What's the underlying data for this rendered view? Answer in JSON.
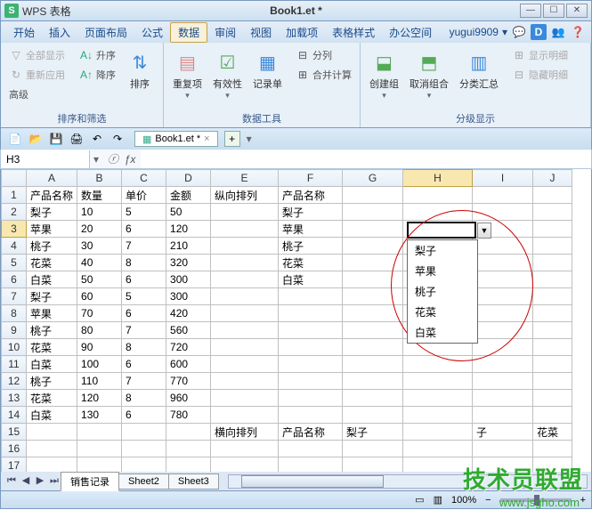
{
  "title_bar": {
    "app_name": "WPS 表格",
    "doc_title": "Book1.et *"
  },
  "menu": {
    "items": [
      "开始",
      "插入",
      "页面布局",
      "公式",
      "数据",
      "审阅",
      "视图",
      "加载项",
      "表格样式",
      "办公空间"
    ],
    "active_index": 4,
    "user": "yugui9909"
  },
  "ribbon": {
    "g1": {
      "show_all": "全部显示",
      "reapply": "重新应用",
      "advanced": "高级",
      "asc": "升序",
      "desc": "降序",
      "sort": "排序",
      "label": "排序和筛选"
    },
    "g2": {
      "dup": "重复项",
      "validity": "有效性",
      "form": "记录单",
      "split": "分列",
      "consolidate": "合并计算",
      "label": "数据工具"
    },
    "g3": {
      "group": "创建组",
      "ungroup": "取消组合",
      "subtotal": "分类汇总",
      "show_detail": "显示明细",
      "hide_detail": "隐藏明细",
      "label": "分级显示"
    }
  },
  "quick_access": {
    "doc_tab": "Book1.et *"
  },
  "name_box": {
    "value": "H3"
  },
  "columns": [
    "A",
    "B",
    "C",
    "D",
    "E",
    "F",
    "G",
    "H",
    "I",
    "J"
  ],
  "headers": {
    "c0": "产品名称",
    "c1": "数量",
    "c2": "单价",
    "c3": "金额",
    "c4": "纵向排列",
    "c5": "产品名称"
  },
  "rows": [
    {
      "r": "1",
      "a": "产品名称",
      "b": "数量",
      "c": "单价",
      "d": "金额",
      "e": "纵向排列",
      "f": "产品名称"
    },
    {
      "r": "2",
      "a": "梨子",
      "b": "10",
      "c": "5",
      "d": "50",
      "f": "梨子"
    },
    {
      "r": "3",
      "a": "苹果",
      "b": "20",
      "c": "6",
      "d": "120",
      "f": "苹果"
    },
    {
      "r": "4",
      "a": "桃子",
      "b": "30",
      "c": "7",
      "d": "210",
      "f": "桃子"
    },
    {
      "r": "5",
      "a": "花菜",
      "b": "40",
      "c": "8",
      "d": "320",
      "f": "花菜"
    },
    {
      "r": "6",
      "a": "白菜",
      "b": "50",
      "c": "6",
      "d": "300",
      "f": "白菜"
    },
    {
      "r": "7",
      "a": "梨子",
      "b": "60",
      "c": "5",
      "d": "300"
    },
    {
      "r": "8",
      "a": "苹果",
      "b": "70",
      "c": "6",
      "d": "420"
    },
    {
      "r": "9",
      "a": "桃子",
      "b": "80",
      "c": "7",
      "d": "560"
    },
    {
      "r": "10",
      "a": "花菜",
      "b": "90",
      "c": "8",
      "d": "720"
    },
    {
      "r": "11",
      "a": "白菜",
      "b": "100",
      "c": "6",
      "d": "600"
    },
    {
      "r": "12",
      "a": "桃子",
      "b": "110",
      "c": "7",
      "d": "770"
    },
    {
      "r": "13",
      "a": "花菜",
      "b": "120",
      "c": "8",
      "d": "960"
    },
    {
      "r": "14",
      "a": "白菜",
      "b": "130",
      "c": "6",
      "d": "780"
    },
    {
      "r": "15",
      "e": "横向排列",
      "f": "产品名称",
      "g": "梨子",
      "i": "子",
      "j": "花菜"
    },
    {
      "r": "16"
    },
    {
      "r": "17"
    }
  ],
  "dropdown": {
    "items": [
      "梨子",
      "苹果",
      "桃子",
      "花菜",
      "白菜"
    ]
  },
  "sheets": {
    "tabs": [
      "销售记录",
      "Sheet2",
      "Sheet3"
    ],
    "active_index": 0
  },
  "status": {
    "zoom": "100%"
  },
  "watermark": {
    "text": "技术员联盟",
    "url": "www.jsgho.com"
  }
}
